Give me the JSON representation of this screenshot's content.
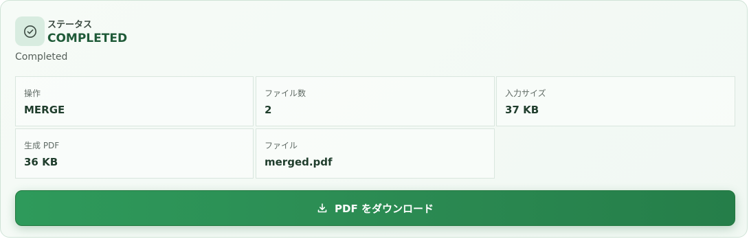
{
  "status": {
    "label": "ステータス",
    "value": "COMPLETED",
    "sub": "Completed",
    "icon": "check-circle-icon"
  },
  "details": [
    {
      "label": "操作",
      "value": "MERGE"
    },
    {
      "label": "ファイル数",
      "value": "2"
    },
    {
      "label": "入力サイズ",
      "value": "37 KB"
    },
    {
      "label": "生成 PDF",
      "value": "36 KB"
    },
    {
      "label": "ファイル",
      "value": "merged.pdf"
    }
  ],
  "download": {
    "label": "PDF をダウンロード",
    "icon": "download-icon"
  },
  "colors": {
    "accent": "#2b8a52",
    "status_text": "#1f5a38"
  }
}
